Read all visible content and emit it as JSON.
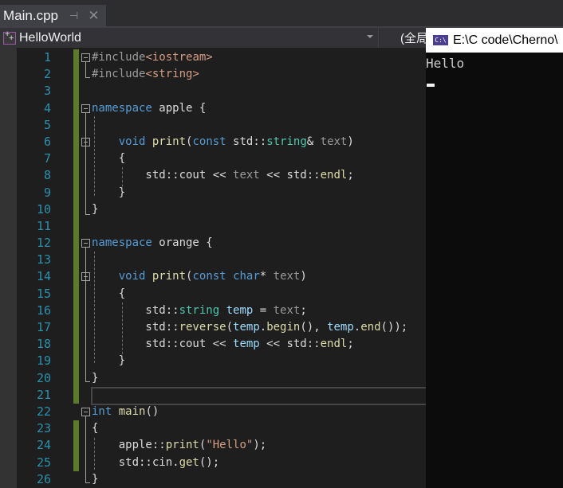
{
  "tab": {
    "title": "Main.cpp",
    "pin_icon": "pin-icon",
    "close_icon": "close-icon"
  },
  "navbar": {
    "project": "HelloWorld",
    "scope": "(全局"
  },
  "editor": {
    "lines": [
      {
        "n": "1",
        "fold": true,
        "chg": true,
        "html": "<span class='pp'>#include</span><span class='inc'>&lt;iostream&gt;</span>"
      },
      {
        "n": "2",
        "chg": true,
        "html": "<span class='pp'>#include</span><span class='inc'>&lt;string&gt;</span>"
      },
      {
        "n": "3",
        "chg": true,
        "html": ""
      },
      {
        "n": "4",
        "fold": true,
        "chg": true,
        "html": "<span class='kw'>namespace</span> apple {"
      },
      {
        "n": "5",
        "chg": true,
        "html": ""
      },
      {
        "n": "6",
        "fold": true,
        "chg": true,
        "html": "    <span class='kw'>void</span> <span class='fn'>print</span>(<span class='kw'>const</span> std::<span class='ty'>string</span>&amp; <span class='pa'>text</span>)"
      },
      {
        "n": "7",
        "chg": true,
        "html": "    {"
      },
      {
        "n": "8",
        "chg": true,
        "html": "        std::cout &lt;&lt; <span class='pa'>text</span> &lt;&lt; std::<span class='fn'>endl</span>;"
      },
      {
        "n": "9",
        "chg": true,
        "html": "    }"
      },
      {
        "n": "10",
        "chg": true,
        "html": "}"
      },
      {
        "n": "11",
        "chg": true,
        "html": ""
      },
      {
        "n": "12",
        "fold": true,
        "chg": true,
        "html": "<span class='kw'>namespace</span> orange {"
      },
      {
        "n": "13",
        "chg": true,
        "html": ""
      },
      {
        "n": "14",
        "fold": true,
        "chg": true,
        "html": "    <span class='kw'>void</span> <span class='fn'>print</span>(<span class='kw'>const</span> <span class='kw'>char</span>* <span class='pa'>text</span>)"
      },
      {
        "n": "15",
        "chg": true,
        "html": "    {"
      },
      {
        "n": "16",
        "chg": true,
        "html": "        std::<span class='ty'>string</span> <span class='var'>temp</span> = <span class='pa'>text</span>;"
      },
      {
        "n": "17",
        "chg": true,
        "html": "        std::<span class='fn'>reverse</span>(<span class='var'>temp</span>.<span class='fn'>begin</span>(), <span class='var'>temp</span>.<span class='fn'>end</span>());"
      },
      {
        "n": "18",
        "chg": true,
        "html": "        std::cout &lt;&lt; <span class='var'>temp</span> &lt;&lt; std::<span class='fn'>endl</span>;"
      },
      {
        "n": "19",
        "chg": true,
        "html": "    }"
      },
      {
        "n": "20",
        "chg": true,
        "html": "}"
      },
      {
        "n": "21",
        "chg": true,
        "cur": true,
        "html": ""
      },
      {
        "n": "22",
        "fold": true,
        "html": "<span class='kw'>int</span> <span class='fn'>main</span>()"
      },
      {
        "n": "23",
        "chg": true,
        "html": "{"
      },
      {
        "n": "24",
        "chg": true,
        "html": "    apple::<span class='fn'>print</span>(<span class='str'>\"Hello\"</span>);"
      },
      {
        "n": "25",
        "chg": true,
        "html": "    std::cin.<span class='fn'>get</span>();"
      },
      {
        "n": "26",
        "html": "}"
      }
    ]
  },
  "console": {
    "title": "E:\\C code\\Cherno\\",
    "icon": "cmd-icon",
    "output": "Hello"
  }
}
